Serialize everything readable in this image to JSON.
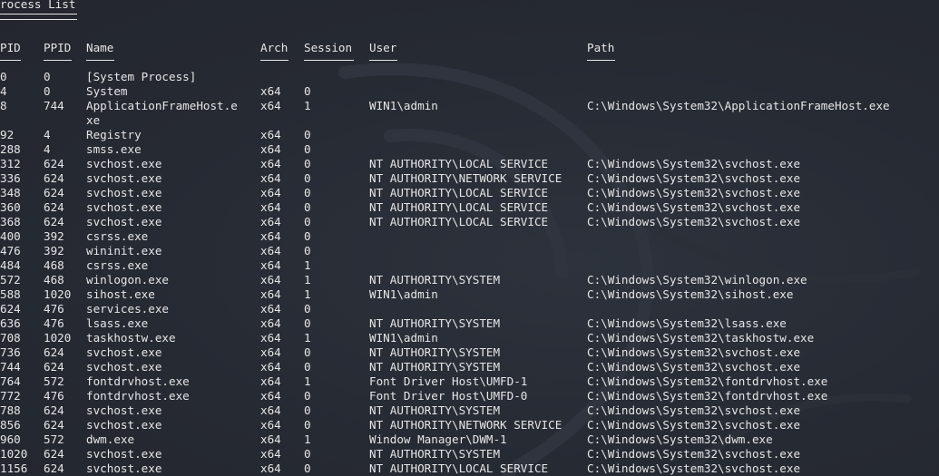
{
  "title": "rocess List",
  "headers": {
    "pid": "PID",
    "ppid": "PPID",
    "name": "Name",
    "arch": "Arch",
    "session": "Session",
    "user": "User",
    "path": "Path"
  },
  "rows": [
    {
      "pid": "0",
      "ppid": "0",
      "name": "[System Process]",
      "arch": "",
      "session": "",
      "user": "",
      "path": ""
    },
    {
      "pid": "4",
      "ppid": "0",
      "name": "System",
      "arch": "x64",
      "session": "0",
      "user": "",
      "path": ""
    },
    {
      "pid": "8",
      "ppid": "744",
      "name": "ApplicationFrameHost.e",
      "arch": "x64",
      "session": "1",
      "user": "WIN1\\admin",
      "path": "C:\\Windows\\System32\\ApplicationFrameHost.exe"
    },
    {
      "pid": "",
      "ppid": "",
      "name": "xe",
      "arch": "",
      "session": "",
      "user": "",
      "path": ""
    },
    {
      "pid": "92",
      "ppid": "4",
      "name": "Registry",
      "arch": "x64",
      "session": "0",
      "user": "",
      "path": ""
    },
    {
      "pid": "288",
      "ppid": "4",
      "name": "smss.exe",
      "arch": "x64",
      "session": "0",
      "user": "",
      "path": ""
    },
    {
      "pid": "312",
      "ppid": "624",
      "name": "svchost.exe",
      "arch": "x64",
      "session": "0",
      "user": "NT AUTHORITY\\LOCAL SERVICE",
      "path": "C:\\Windows\\System32\\svchost.exe"
    },
    {
      "pid": "336",
      "ppid": "624",
      "name": "svchost.exe",
      "arch": "x64",
      "session": "0",
      "user": "NT AUTHORITY\\NETWORK SERVICE",
      "path": "C:\\Windows\\System32\\svchost.exe"
    },
    {
      "pid": "348",
      "ppid": "624",
      "name": "svchost.exe",
      "arch": "x64",
      "session": "0",
      "user": "NT AUTHORITY\\LOCAL SERVICE",
      "path": "C:\\Windows\\System32\\svchost.exe"
    },
    {
      "pid": "360",
      "ppid": "624",
      "name": "svchost.exe",
      "arch": "x64",
      "session": "0",
      "user": "NT AUTHORITY\\LOCAL SERVICE",
      "path": "C:\\Windows\\System32\\svchost.exe"
    },
    {
      "pid": "368",
      "ppid": "624",
      "name": "svchost.exe",
      "arch": "x64",
      "session": "0",
      "user": "NT AUTHORITY\\LOCAL SERVICE",
      "path": "C:\\Windows\\System32\\svchost.exe"
    },
    {
      "pid": "400",
      "ppid": "392",
      "name": "csrss.exe",
      "arch": "x64",
      "session": "0",
      "user": "",
      "path": ""
    },
    {
      "pid": "476",
      "ppid": "392",
      "name": "wininit.exe",
      "arch": "x64",
      "session": "0",
      "user": "",
      "path": ""
    },
    {
      "pid": "484",
      "ppid": "468",
      "name": "csrss.exe",
      "arch": "x64",
      "session": "1",
      "user": "",
      "path": ""
    },
    {
      "pid": "572",
      "ppid": "468",
      "name": "winlogon.exe",
      "arch": "x64",
      "session": "1",
      "user": "NT AUTHORITY\\SYSTEM",
      "path": "C:\\Windows\\System32\\winlogon.exe"
    },
    {
      "pid": "588",
      "ppid": "1020",
      "name": "sihost.exe",
      "arch": "x64",
      "session": "1",
      "user": "WIN1\\admin",
      "path": "C:\\Windows\\System32\\sihost.exe"
    },
    {
      "pid": "624",
      "ppid": "476",
      "name": "services.exe",
      "arch": "x64",
      "session": "0",
      "user": "",
      "path": ""
    },
    {
      "pid": "636",
      "ppid": "476",
      "name": "lsass.exe",
      "arch": "x64",
      "session": "0",
      "user": "NT AUTHORITY\\SYSTEM",
      "path": "C:\\Windows\\System32\\lsass.exe"
    },
    {
      "pid": "708",
      "ppid": "1020",
      "name": "taskhostw.exe",
      "arch": "x64",
      "session": "1",
      "user": "WIN1\\admin",
      "path": "C:\\Windows\\System32\\taskhostw.exe"
    },
    {
      "pid": "736",
      "ppid": "624",
      "name": "svchost.exe",
      "arch": "x64",
      "session": "0",
      "user": "NT AUTHORITY\\SYSTEM",
      "path": "C:\\Windows\\System32\\svchost.exe"
    },
    {
      "pid": "744",
      "ppid": "624",
      "name": "svchost.exe",
      "arch": "x64",
      "session": "0",
      "user": "NT AUTHORITY\\SYSTEM",
      "path": "C:\\Windows\\System32\\svchost.exe"
    },
    {
      "pid": "764",
      "ppid": "572",
      "name": "fontdrvhost.exe",
      "arch": "x64",
      "session": "1",
      "user": "Font Driver Host\\UMFD-1",
      "path": "C:\\Windows\\System32\\fontdrvhost.exe"
    },
    {
      "pid": "772",
      "ppid": "476",
      "name": "fontdrvhost.exe",
      "arch": "x64",
      "session": "0",
      "user": "Font Driver Host\\UMFD-0",
      "path": "C:\\Windows\\System32\\fontdrvhost.exe"
    },
    {
      "pid": "788",
      "ppid": "624",
      "name": "svchost.exe",
      "arch": "x64",
      "session": "0",
      "user": "NT AUTHORITY\\SYSTEM",
      "path": "C:\\Windows\\System32\\svchost.exe"
    },
    {
      "pid": "856",
      "ppid": "624",
      "name": "svchost.exe",
      "arch": "x64",
      "session": "0",
      "user": "NT AUTHORITY\\NETWORK SERVICE",
      "path": "C:\\Windows\\System32\\svchost.exe"
    },
    {
      "pid": "960",
      "ppid": "572",
      "name": "dwm.exe",
      "arch": "x64",
      "session": "1",
      "user": "Window Manager\\DWM-1",
      "path": "C:\\Windows\\System32\\dwm.exe"
    },
    {
      "pid": "1020",
      "ppid": "624",
      "name": "svchost.exe",
      "arch": "x64",
      "session": "0",
      "user": "NT AUTHORITY\\SYSTEM",
      "path": "C:\\Windows\\System32\\svchost.exe"
    },
    {
      "pid": "1156",
      "ppid": "624",
      "name": "svchost.exe",
      "arch": "x64",
      "session": "0",
      "user": "NT AUTHORITY\\LOCAL SERVICE",
      "path": "C:\\Windows\\System32\\svchost.exe"
    }
  ]
}
